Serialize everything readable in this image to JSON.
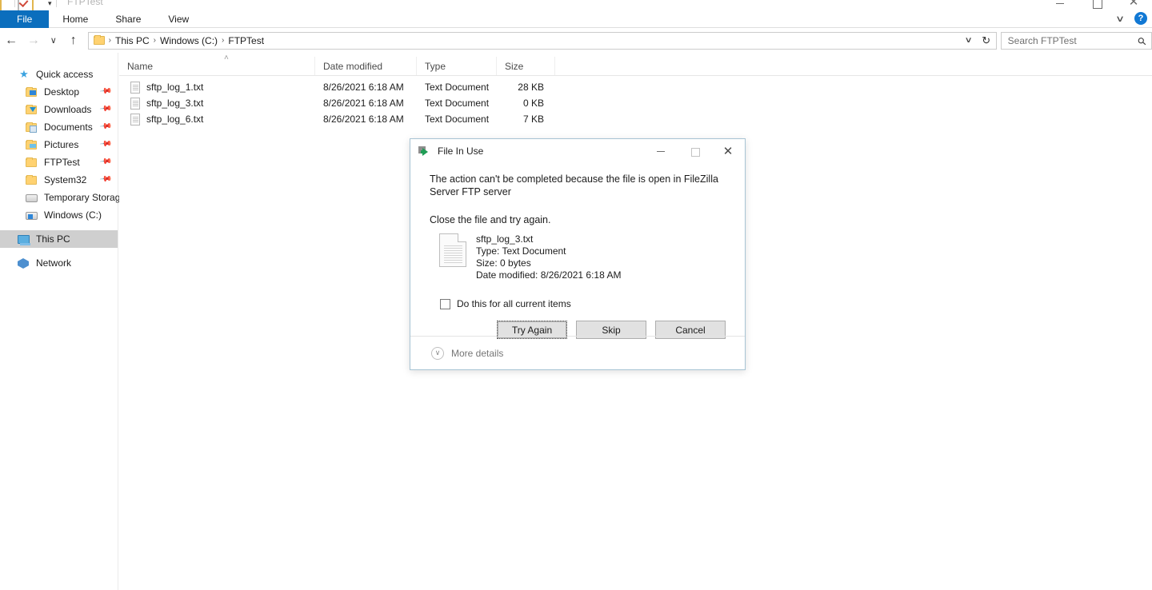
{
  "window": {
    "title": "FTPTest",
    "quick_access_icons": [
      "folder-icon",
      "checkbox-icon",
      "folder-icon",
      "dropdown-caret-icon"
    ],
    "controls": {
      "minimize": "—",
      "maximize": "□",
      "close": "✕"
    }
  },
  "ribbon": {
    "tabs": [
      {
        "label": "File",
        "active": true
      },
      {
        "label": "Home",
        "active": false
      },
      {
        "label": "Share",
        "active": false
      },
      {
        "label": "View",
        "active": false
      }
    ],
    "collapse_caret": "∨",
    "help_label": "?"
  },
  "address_bar": {
    "back": "←",
    "forward": "→",
    "recent": "∨",
    "up": "↑",
    "breadcrumbs": [
      "This PC",
      "Windows (C:)",
      "FTPTest"
    ],
    "separator": "›",
    "dropdown_caret": "∨",
    "refresh": "↻"
  },
  "search": {
    "placeholder": "Search FTPTest",
    "value": "",
    "icon": "search-icon"
  },
  "sidebar": {
    "items": [
      {
        "label": "Quick access",
        "icon": "star-icon",
        "pinned": false,
        "indent": false,
        "selected": false
      },
      {
        "label": "Desktop",
        "icon": "folder-desktop-icon",
        "pinned": true,
        "indent": true,
        "selected": false
      },
      {
        "label": "Downloads",
        "icon": "folder-downloads-icon",
        "pinned": true,
        "indent": true,
        "selected": false
      },
      {
        "label": "Documents",
        "icon": "folder-documents-icon",
        "pinned": true,
        "indent": true,
        "selected": false
      },
      {
        "label": "Pictures",
        "icon": "folder-pictures-icon",
        "pinned": true,
        "indent": true,
        "selected": false
      },
      {
        "label": "FTPTest",
        "icon": "folder-icon",
        "pinned": true,
        "indent": true,
        "selected": false
      },
      {
        "label": "System32",
        "icon": "folder-icon",
        "pinned": true,
        "indent": true,
        "selected": false
      },
      {
        "label": "Temporary Storage",
        "icon": "drive-icon",
        "pinned": false,
        "indent": true,
        "selected": false
      },
      {
        "label": "Windows (C:)",
        "icon": "windows-drive-icon",
        "pinned": false,
        "indent": true,
        "selected": false
      },
      {
        "label": "This PC",
        "icon": "this-pc-icon",
        "pinned": false,
        "indent": false,
        "selected": true
      },
      {
        "label": "Network",
        "icon": "network-icon",
        "pinned": false,
        "indent": false,
        "selected": false
      }
    ],
    "pin_glyph": "📌"
  },
  "file_list": {
    "sort_indicator": "˄",
    "columns": [
      "Name",
      "Date modified",
      "Type",
      "Size"
    ],
    "rows": [
      {
        "name": "sftp_log_1.txt",
        "date": "8/26/2021 6:18 AM",
        "type": "Text Document",
        "size": "28 KB"
      },
      {
        "name": "sftp_log_3.txt",
        "date": "8/26/2021 6:18 AM",
        "type": "Text Document",
        "size": "0 KB"
      },
      {
        "name": "sftp_log_6.txt",
        "date": "8/26/2021 6:18 AM",
        "type": "Text Document",
        "size": "7 KB"
      }
    ]
  },
  "dialog": {
    "title": "File In Use",
    "icon": "move-file-icon",
    "controls": {
      "minimize": "—",
      "maximize": "□",
      "close": "✕"
    },
    "message": "The action can't be completed because the file is open in FileZilla Server FTP server",
    "instruction": "Close the file and try again.",
    "file": {
      "name": "sftp_log_3.txt",
      "type": "Type: Text Document",
      "size": "Size: 0 bytes",
      "date_modified": "Date modified: 8/26/2021 6:18 AM"
    },
    "checkbox": {
      "label": "Do this for all current items",
      "checked": false
    },
    "buttons": [
      {
        "label": "Try Again",
        "focused": true
      },
      {
        "label": "Skip",
        "focused": false
      },
      {
        "label": "Cancel",
        "focused": false
      }
    ],
    "more_details": {
      "label": "More details",
      "caret": "∨"
    }
  },
  "colors": {
    "accent": "#0b6ebd",
    "dialog_border": "#a8c4d4",
    "selection": "#cfcfcf",
    "folder": "#ffd271"
  }
}
